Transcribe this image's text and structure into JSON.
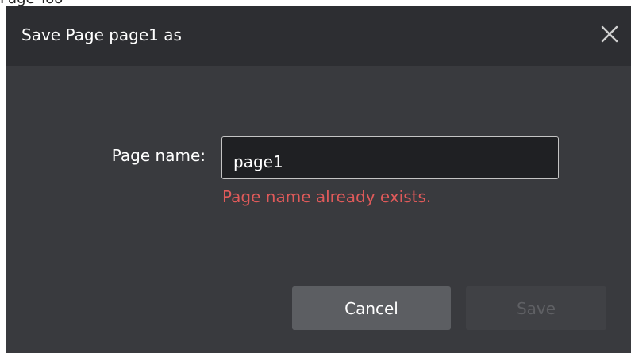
{
  "page_top_strip": {
    "text": "Page Too"
  },
  "dialog": {
    "title": "Save Page page1 as",
    "close_icon": "close-icon",
    "field_label": "Page name:",
    "input_value": "page1",
    "error_message": "Page name already exists.",
    "cancel_label": "Cancel",
    "save_label": "Save",
    "save_disabled": true
  },
  "colors": {
    "dialog_background": "#393a3e",
    "title_bar_background": "#2d2e32",
    "input_background": "#1f2023",
    "input_border": "#c4c4c4",
    "error_text": "#e05a5a",
    "cancel_button": "#5c5e62",
    "save_button_disabled": "#404145",
    "save_text_disabled": "#5f6064"
  }
}
